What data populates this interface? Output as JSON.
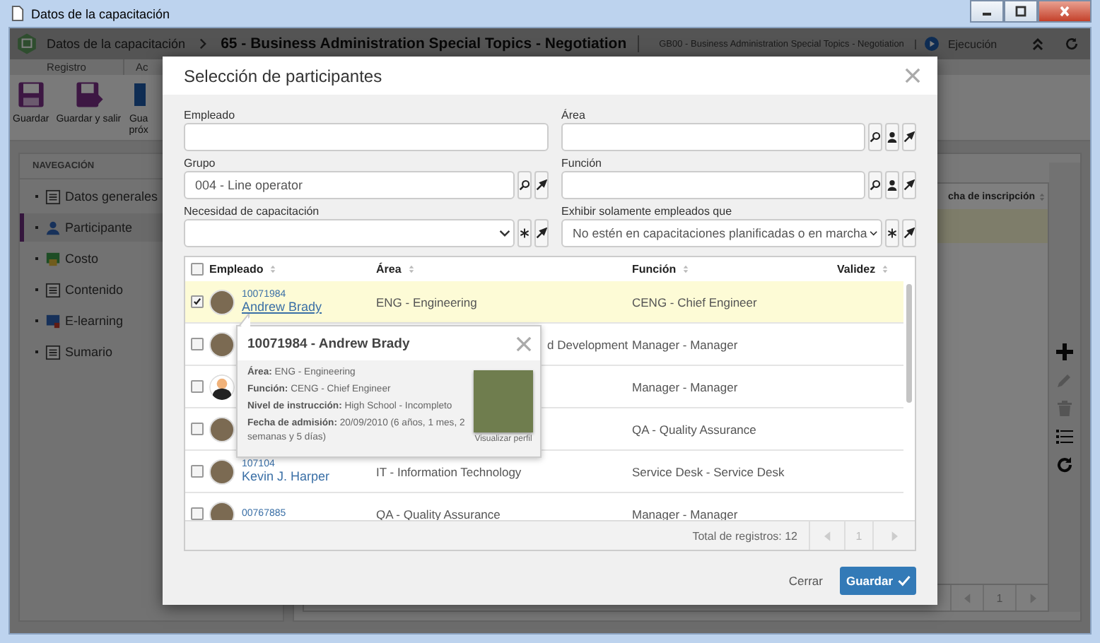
{
  "window": {
    "title": "Datos de la capacitación"
  },
  "header": {
    "breadcrumb": "Datos de la capacitación",
    "title": "65 - Business Administration Special Topics - Negotiation",
    "subtitle": "GB00 - Business Administration Special Topics - Negotiation",
    "status": "Ejecución"
  },
  "ribbon": {
    "groups": [
      "Registro",
      "Ac"
    ],
    "buttons": [
      {
        "kind": "save",
        "label": "Guardar"
      },
      {
        "kind": "save-exit",
        "label": "Guardar y salir"
      },
      {
        "kind": "save-next",
        "label": "Gua próx"
      }
    ]
  },
  "navigation": {
    "title": "NAVEGACIÓN",
    "items": [
      {
        "kind": "general",
        "label": "Datos generales",
        "selected": false
      },
      {
        "kind": "people",
        "label": "Participante",
        "selected": true
      },
      {
        "kind": "cost",
        "label": "Costo",
        "selected": false
      },
      {
        "kind": "content",
        "label": "Contenido",
        "selected": false
      },
      {
        "kind": "elearning",
        "label": "E-learning",
        "selected": false
      },
      {
        "kind": "summary",
        "label": "Sumario",
        "selected": false
      }
    ]
  },
  "background_table": {
    "column": "cha de inscripción",
    "page": "1"
  },
  "side_tools": [
    {
      "kind": "add",
      "disabled": false
    },
    {
      "kind": "edit",
      "disabled": true
    },
    {
      "kind": "delete",
      "disabled": true
    },
    {
      "kind": "list",
      "disabled": false
    },
    {
      "kind": "refresh",
      "disabled": false
    }
  ],
  "dialog": {
    "title": "Selección de participantes",
    "fields": [
      {
        "label": "Empleado",
        "kind": "text"
      },
      {
        "label": "Área",
        "kind": "lookup"
      },
      {
        "label": "Grupo",
        "kind": "group",
        "value": "004 - Line operator"
      },
      {
        "label": "Función",
        "kind": "lookup"
      },
      {
        "label": "Necesidad de capacitación",
        "kind": "select"
      },
      {
        "label": "Exhibir solamente empleados que",
        "kind": "select",
        "value": "No estén en capacitaciones planificadas o en marcha"
      }
    ],
    "table": {
      "select_all": false,
      "columns": [
        "Empleado",
        "Área",
        "Función",
        "Validez"
      ],
      "rows": [
        {
          "kind": "photo",
          "code": "10071984",
          "name": "Andrew Brady",
          "area": "ENG - Engineering",
          "role": "CENG - Chief Engineer",
          "checked": true,
          "selected": true,
          "covered": false
        },
        {
          "kind": "photo",
          "area": "d Development",
          "role": "Manager - Manager",
          "checked": false,
          "selected": false,
          "covered": true
        },
        {
          "kind": "silhouette",
          "role": "Manager - Manager",
          "checked": false,
          "selected": false
        },
        {
          "kind": "photo",
          "role": "QA - Quality Assurance",
          "checked": false,
          "selected": false
        },
        {
          "kind": "photo",
          "code": "107104",
          "name": "Kevin J. Harper",
          "area": "IT - Information Technology",
          "role": "Service Desk - Service Desk",
          "checked": false,
          "selected": false,
          "covered": false
        },
        {
          "kind": "photo",
          "code": "00767885",
          "area": "QA - Quality Assurance",
          "role": "Manager - Manager",
          "checked": false,
          "selected": false,
          "covered": false
        }
      ],
      "total": "Total de registros: 12",
      "page": "1"
    },
    "popover": {
      "title": "10071984 - Andrew Brady",
      "details": [
        "**Área:** ENG - Engineering",
        "**Función:** CENG - Chief Engineer",
        "**Nivel de instrucción:** High School - Incompleto",
        "**Fecha de admisión:** 20/09/2010 (6 años, 1 mes, 2 semanas y 5 días)"
      ],
      "caption": "Visualizar perfil"
    },
    "buttons": {
      "cancel": "Cerrar",
      "save": "Guardar"
    }
  }
}
